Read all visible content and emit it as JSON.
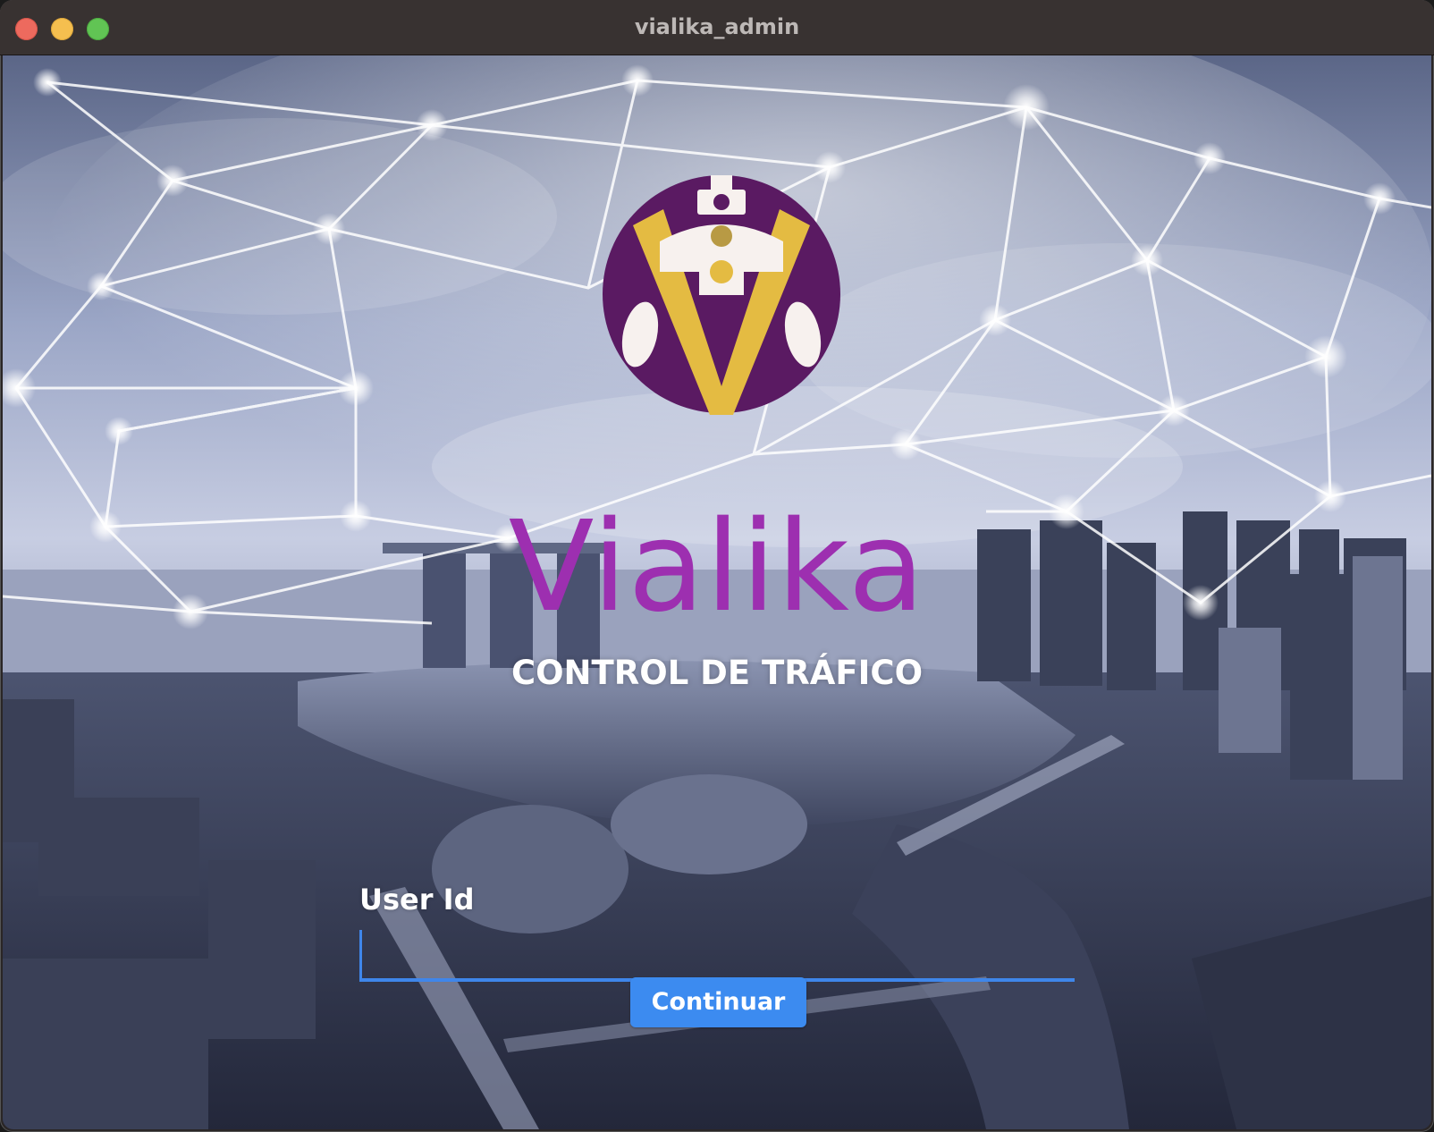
{
  "window": {
    "title": "vialika_admin"
  },
  "brand": {
    "name": "Vialika",
    "subtitle": "CONTROL DE TRÁFICO",
    "logo_icon": "vialika-traffic-light-v-logo"
  },
  "login_form": {
    "user_label": "User Id",
    "user_value": "",
    "continue_label": "Continuar"
  },
  "colors": {
    "brand_purple": "#9d2fb0",
    "logo_purple": "#5a1a62",
    "logo_gold": "#e4bb42",
    "accent_blue": "#3c8bf0"
  }
}
